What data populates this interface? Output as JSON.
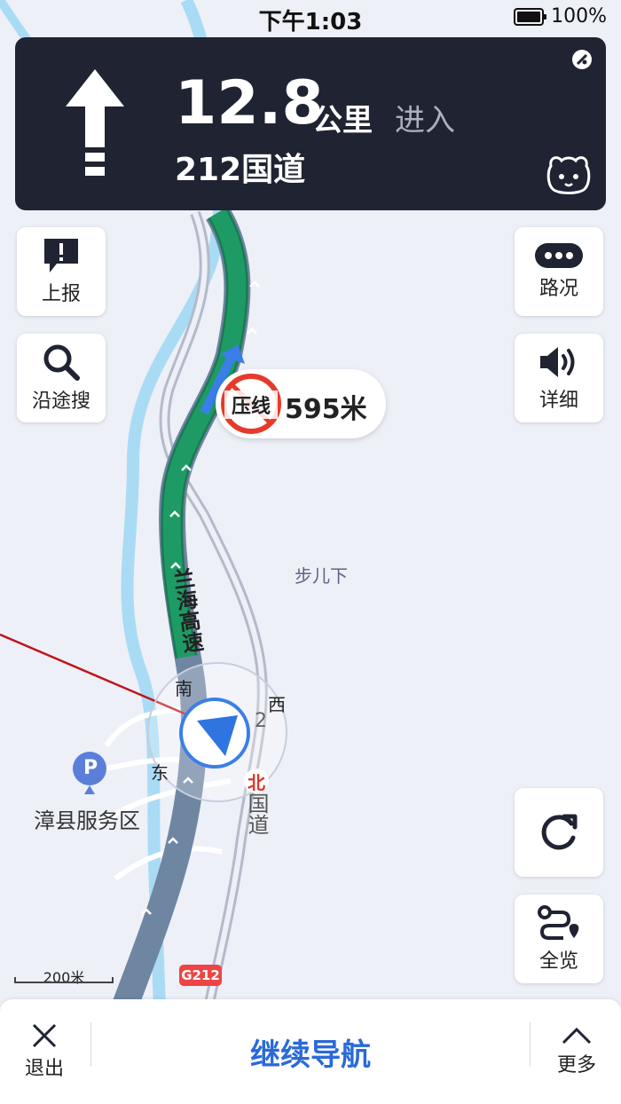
{
  "status_bar": {
    "time": "下午1:03",
    "battery": "100%"
  },
  "guidance": {
    "distance": "12.8",
    "unit": "公里",
    "action": "进入",
    "road": "212国道"
  },
  "left_buttons": [
    {
      "label": "上报"
    },
    {
      "label": "沿途搜"
    }
  ],
  "right_buttons": [
    {
      "label": "路况"
    },
    {
      "label": "详细"
    },
    {
      "label": "全览"
    }
  ],
  "warning": {
    "sign_text": "压线",
    "distance": "595米"
  },
  "map_labels": {
    "highway": "兰海高速",
    "village": "步儿下",
    "service_area": "漳县服务区",
    "compass_n": "北",
    "compass_s": "南",
    "compass_e": "东",
    "compass_w": "西",
    "road_name": "国道",
    "road_number": "2",
    "shield": "G212",
    "scale": "200米"
  },
  "bottom_bar": {
    "exit": "退出",
    "continue": "继续导航",
    "more": "更多"
  },
  "colors": {
    "panel": "#1f2332",
    "route": "#1a8a5a",
    "accent": "#2a6ad8",
    "warning_ring": "#e63b2a"
  }
}
